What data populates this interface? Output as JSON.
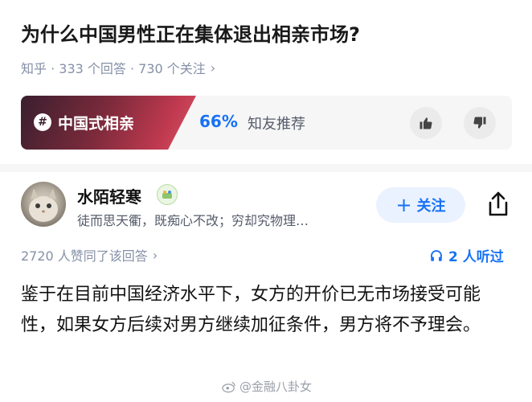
{
  "question": {
    "title": "为什么中国男性正在集体退出相亲市场?",
    "meta": "知乎 · 333 个回答 · 730 个关注",
    "meta_chevron": "›"
  },
  "topic": {
    "hash_symbol": "#",
    "name": "中国式相亲",
    "recommend_pct": "66%",
    "recommend_label": "知友推荐",
    "accent_color": "#1772f6"
  },
  "author": {
    "name": "水陌轻寒",
    "bio": "徒而思天衢，既痴心不改；穷却究物理…",
    "follow_label": "关注",
    "follow_plus": "+"
  },
  "stats": {
    "upvotes": "2720 人赞同了该回答",
    "upvote_chevron": "›",
    "listen": "2 人听过"
  },
  "answer": {
    "text": "鉴于在目前中国经济水平下，女方的开价已无市场接受可能性，如果女方后续对男方继续加征条件，男方将不予理会。"
  },
  "watermark": {
    "text": "@金融八卦女"
  },
  "icons": [
    "thumb-up-icon",
    "thumb-down-icon",
    "share-icon",
    "headphones-icon",
    "weibo-icon",
    "hash-icon"
  ]
}
